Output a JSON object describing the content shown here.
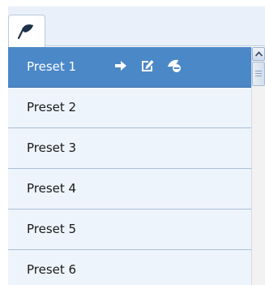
{
  "tabs": [
    {
      "icon": "flag-icon",
      "active": true
    }
  ],
  "presets": [
    {
      "label": "Preset 1",
      "selected": true
    },
    {
      "label": "Preset 2",
      "selected": false
    },
    {
      "label": "Preset 3",
      "selected": false
    },
    {
      "label": "Preset 4",
      "selected": false
    },
    {
      "label": "Preset 5",
      "selected": false
    },
    {
      "label": "Preset 6",
      "selected": false
    }
  ],
  "row_actions": [
    {
      "icon": "arrow-right-icon",
      "action": "call"
    },
    {
      "icon": "edit-icon",
      "action": "set"
    },
    {
      "icon": "clear-icon",
      "action": "clear"
    }
  ],
  "colors": {
    "selected_row": "#4b88c8",
    "row_background": "#eef4fb",
    "row_divider": "#a9bfd6",
    "tabstrip_background": "#e9f0fa"
  }
}
